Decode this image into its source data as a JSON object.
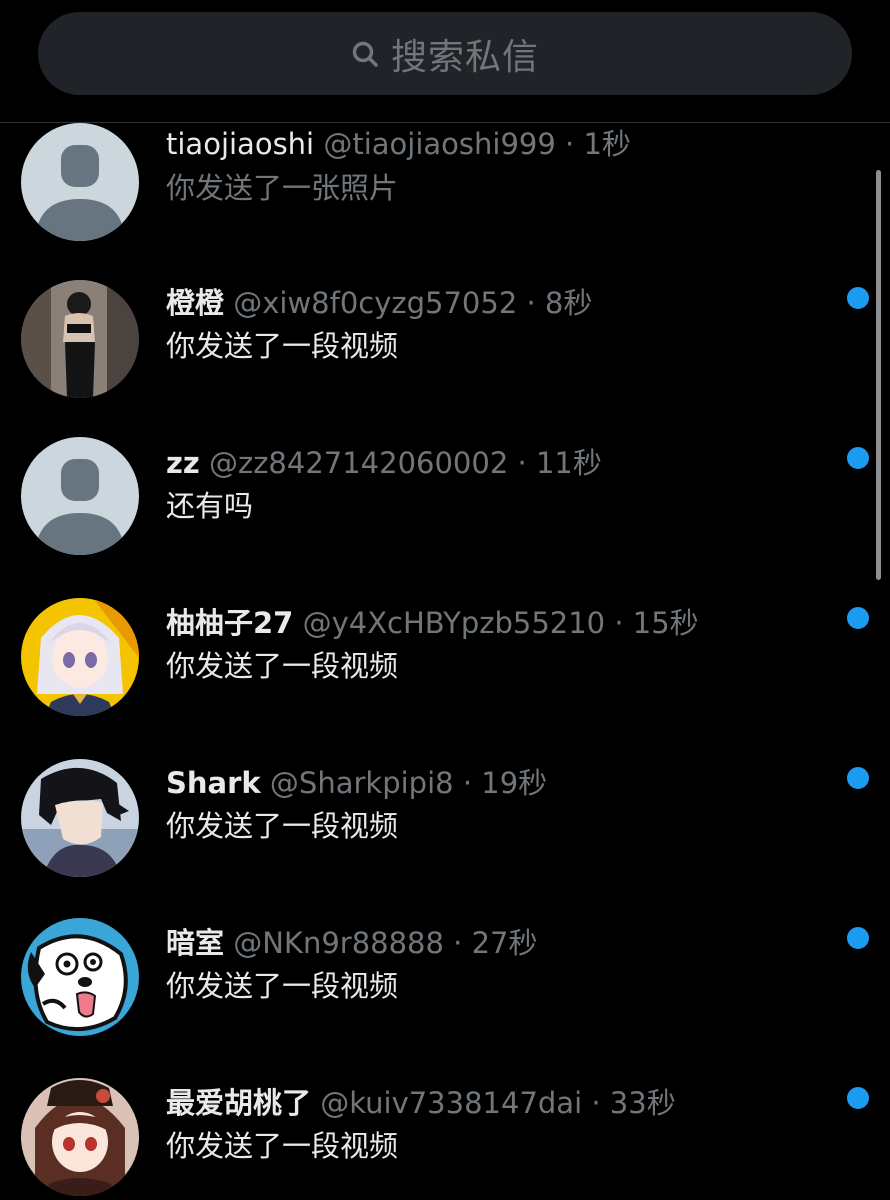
{
  "search": {
    "placeholder": "搜索私信",
    "icon": "search-icon"
  },
  "conversations": [
    {
      "display_name": "tiaojiaoshi",
      "handle": "@tiaojiaoshi999",
      "time": "· 1秒",
      "preview": "你发送了一张照片",
      "unread": false,
      "avatar": "default-avatar"
    },
    {
      "display_name": "橙橙",
      "handle": "@xiw8f0cyzg57052",
      "time": "· 8秒",
      "preview": "你发送了一段视频",
      "unread": true,
      "avatar": "photo-avatar"
    },
    {
      "display_name": "zz",
      "handle": "@zz8427142060002",
      "time": "· 11秒",
      "preview": "还有吗",
      "unread": true,
      "avatar": "default-avatar"
    },
    {
      "display_name": "柚柚子27",
      "handle": "@y4XcHBYpzb55210",
      "time": "· 15秒",
      "preview": "你发送了一段视频",
      "unread": true,
      "avatar": "anime-girl-avatar"
    },
    {
      "display_name": "Shark",
      "handle": "@Sharkpipi8",
      "time": "· 19秒",
      "preview": "你发送了一段视频",
      "unread": true,
      "avatar": "anime-boy-avatar"
    },
    {
      "display_name": "暗室",
      "handle": "@NKn9r88888",
      "time": "· 27秒",
      "preview": "你发送了一段视频",
      "unread": true,
      "avatar": "cartoon-dog-avatar"
    },
    {
      "display_name": "最爱胡桃了",
      "handle": "@kuiv7338147dai",
      "time": "· 33秒",
      "preview": "你发送了一段视频",
      "unread": true,
      "avatar": "anime-hutao-avatar"
    }
  ],
  "colors": {
    "background": "#000000",
    "search_bg": "#202327",
    "muted_text": "#71767b",
    "primary_text": "#e7e9ea",
    "unread_dot": "#1d9bf0"
  }
}
